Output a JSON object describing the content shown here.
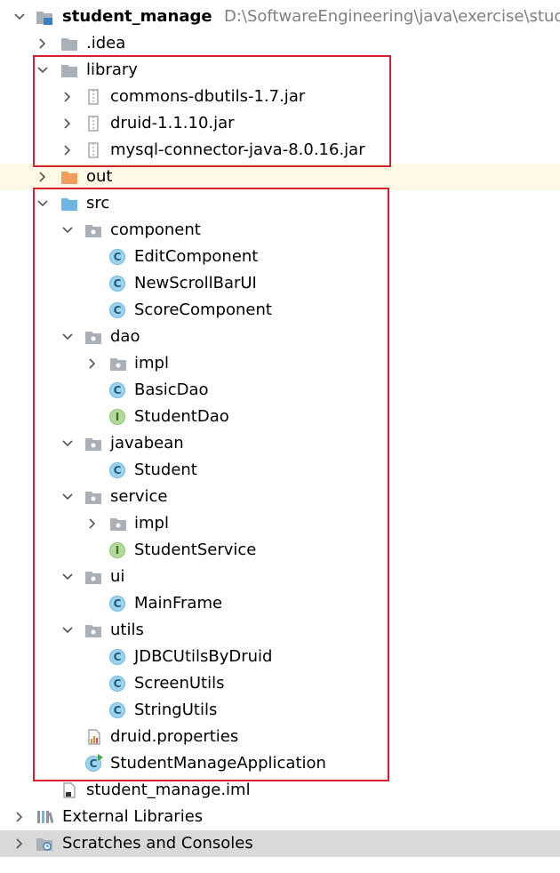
{
  "colors": {
    "folder_gray": "#a9b0b8",
    "folder_blue": "#6cb7e3",
    "folder_orange": "#f49c5b",
    "class_blue": "#9bd2ee",
    "interface_green": "#b3d99b",
    "highlight_box": "#d6202f",
    "path_gray": "#7f7f7f"
  },
  "project": {
    "name": "student_manage",
    "path": "D:\\SoftwareEngineering\\java\\exercise\\stud"
  },
  "tree": {
    "idea": ".idea",
    "library": {
      "label": "library",
      "jars": [
        "commons-dbutils-1.7.jar",
        "druid-1.1.10.jar",
        "mysql-connector-java-8.0.16.jar"
      ]
    },
    "out": "out",
    "src": {
      "label": "src",
      "component": {
        "label": "component",
        "items": [
          "EditComponent",
          "NewScrollBarUI",
          "ScoreComponent"
        ]
      },
      "dao": {
        "label": "dao",
        "impl": "impl",
        "items": [
          "BasicDao",
          "StudentDao"
        ]
      },
      "javabean": {
        "label": "javabean",
        "items": [
          "Student"
        ]
      },
      "service": {
        "label": "service",
        "impl": "impl",
        "items": [
          "StudentService"
        ]
      },
      "ui": {
        "label": "ui",
        "items": [
          "MainFrame"
        ]
      },
      "utils": {
        "label": "utils",
        "items": [
          "JDBCUtilsByDruid",
          "ScreenUtils",
          "StringUtils"
        ]
      },
      "properties_file": "druid.properties",
      "app_class": "StudentManageApplication"
    },
    "iml_file": "student_manage.iml",
    "external_libraries": "External Libraries",
    "scratches": "Scratches and Consoles"
  },
  "icons": {
    "class_letter": "C",
    "interface_letter": "I"
  }
}
